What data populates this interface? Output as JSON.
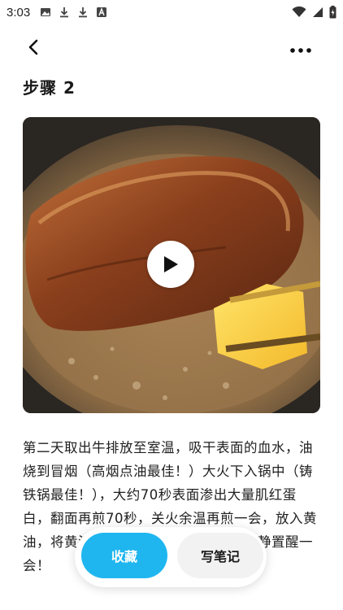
{
  "status_bar": {
    "time": "3:03",
    "icons_left": [
      "image-icon",
      "download-icon",
      "download-icon",
      "font-icon"
    ],
    "icons_right": [
      "wifi-icon",
      "signal-icon",
      "battery-icon"
    ]
  },
  "nav": {
    "back_icon": "chevron-left-icon",
    "more_icon": "more-horizontal-icon"
  },
  "step": {
    "title": "步骤 2"
  },
  "video": {
    "play_icon": "play-icon"
  },
  "description": "第二天取出牛排放至室温，吸干表面的血水，油烧到冒烟（高烟点油最佳！）大火下入锅中（铸铁锅最佳！），大约70秒表面渗出大量肌红蛋白，翻面再煎70秒，关火余温再煎一会，放入黄油，将黄油汁淋在牛排上，增添风味，静置醒一会！",
  "actions": {
    "collect_label": "收藏",
    "note_label": "写笔记"
  },
  "colors": {
    "accent": "#1fb6f0",
    "secondary_button": "#f2f2f2"
  }
}
